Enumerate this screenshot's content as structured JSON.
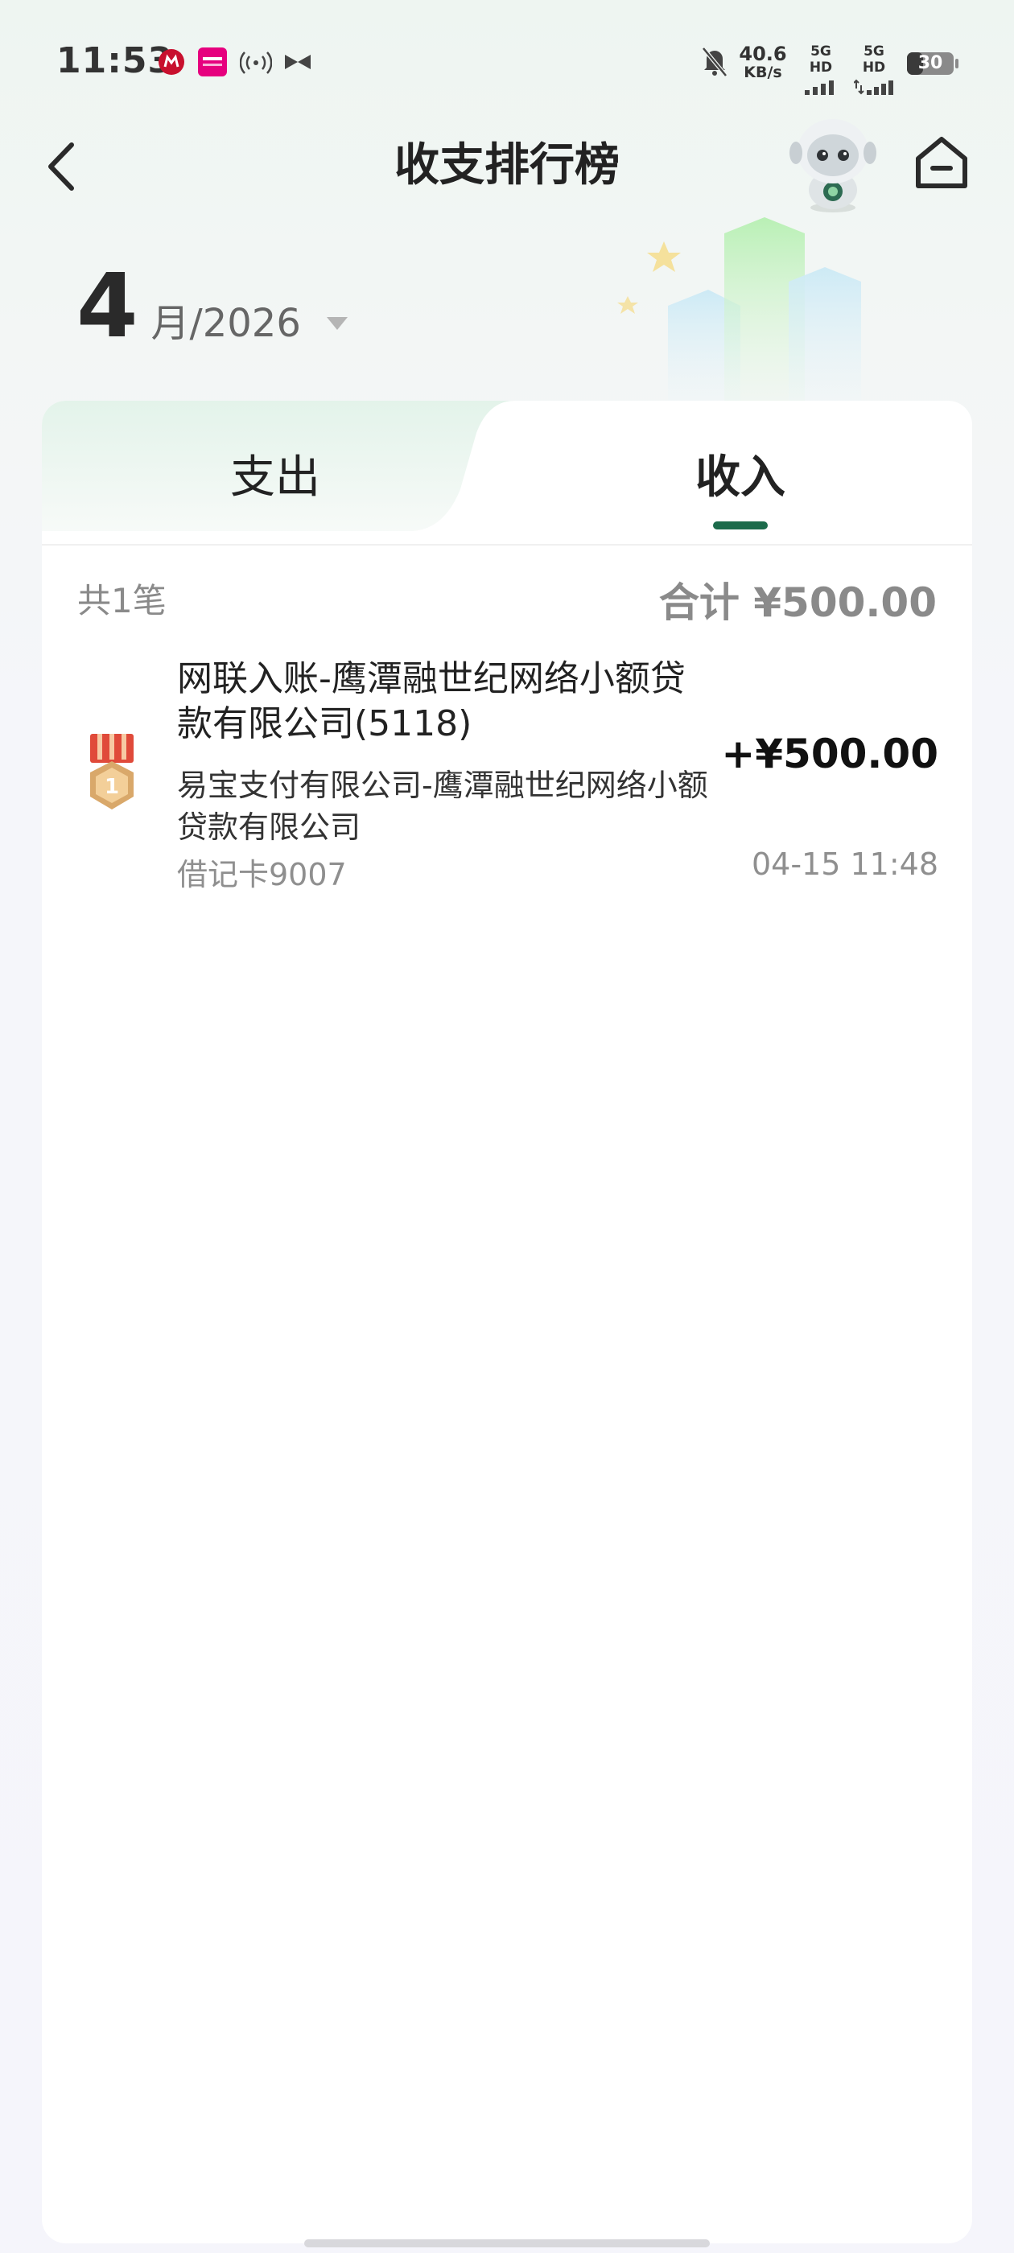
{
  "status_bar": {
    "time": "11:53",
    "net_speed_value": "40.6",
    "net_speed_unit": "KB/s",
    "sim1_label": "5G HD",
    "sim2_label": "5G HD",
    "battery": "30",
    "icons": [
      "cmb-logo-icon",
      "pink-app-icon",
      "hotspot-icon",
      "bowtie-icon",
      "mute-icon",
      "signal-icon",
      "signal-icon",
      "battery-icon"
    ]
  },
  "header": {
    "title": "收支排行榜",
    "back_icon": "chevron-left-icon",
    "assistant_icon": "robot-assistant-icon",
    "home_icon": "home-icon"
  },
  "month_selector": {
    "month": "4",
    "year_label": "月/2026"
  },
  "tabs": [
    {
      "label": "支出",
      "active": false
    },
    {
      "label": "收入",
      "active": true
    }
  ],
  "summary": {
    "count": "共1笔",
    "total": "合计 ¥500.00"
  },
  "records": [
    {
      "rank": "1",
      "title": "网联入账-鹰潭融世纪网络小额贷款有限公司(5118)",
      "title_line1": "网联入账-鹰潭融世纪网络小额贷",
      "title_line2": "款有限公司(5118)",
      "subtitle_line1": "易宝支付有限公司-鹰潭融世纪网络小额",
      "subtitle_line2": "贷款有限公司",
      "card": "借记卡9007",
      "amount": "+¥500.00",
      "time": "04-15 11:48"
    }
  ],
  "colors": {
    "accent": "#1c6b4b",
    "muted_text": "#8a8a8a",
    "background_top": "#eef5f1",
    "background_bottom": "#f5f5fb"
  }
}
